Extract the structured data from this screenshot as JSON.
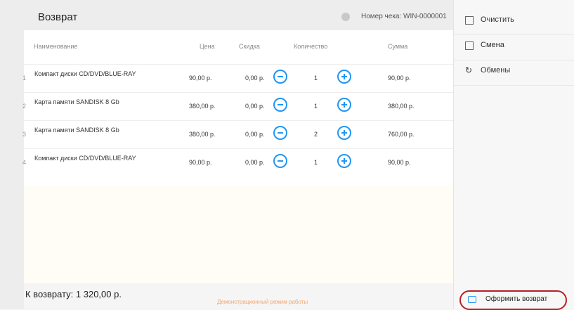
{
  "header": {
    "title": "Возврат",
    "receipt_label": "Номер чека: WIN-0000001"
  },
  "table": {
    "columns": {
      "name": "Наименование",
      "price": "Цена",
      "discount": "Скидка",
      "qty": "Количество",
      "sum": "Сумма"
    },
    "rows": [
      {
        "num": "1",
        "name": "Компакт диски CD/DVD/BLUE-RAY",
        "price": "90,00 р.",
        "discount": "0,00 р.",
        "qty": "1",
        "sum": "90,00 р."
      },
      {
        "num": "2",
        "name": "Карта памяти SANDISK 8 Gb",
        "price": "380,00 р.",
        "discount": "0,00 р.",
        "qty": "1",
        "sum": "380,00 р."
      },
      {
        "num": "3",
        "name": "Карта памяти SANDISK 8 Gb",
        "price": "380,00 р.",
        "discount": "0,00 р.",
        "qty": "2",
        "sum": "760,00 р."
      },
      {
        "num": "4",
        "name": "Компакт диски CD/DVD/BLUE-RAY",
        "price": "90,00 р.",
        "discount": "0,00 р.",
        "qty": "1",
        "sum": "90,00 р."
      }
    ]
  },
  "footer": {
    "total": "К возврату: 1 320,00 р.",
    "demo": "Демонстрационный режим работы"
  },
  "sidebar": {
    "items": [
      {
        "label": "Очистить"
      },
      {
        "label": "Смена"
      },
      {
        "label": "Обмены"
      }
    ],
    "submit_label": "Оформить возврат"
  }
}
